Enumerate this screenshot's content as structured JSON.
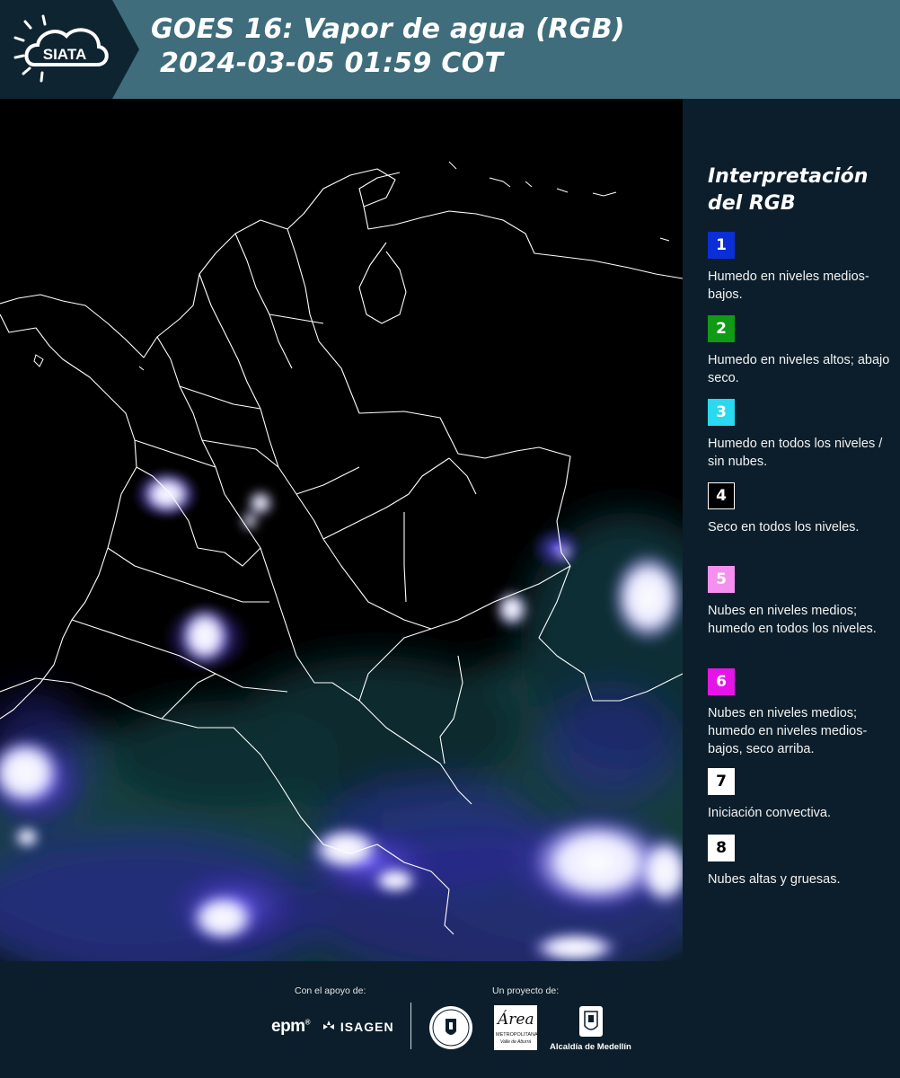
{
  "header": {
    "logo_text": "SIATA",
    "title_line1": "GOES 16: Vapor de agua (RGB)",
    "title_line2": "2024-03-05 01:59 COT"
  },
  "legend": {
    "title_line1": "Interpretación",
    "title_line2": "del RGB",
    "items": [
      {
        "number": "1",
        "color": "#0b2fd6",
        "text_color": "#ffffff",
        "description": "Humedo en niveles medios-bajos."
      },
      {
        "number": "2",
        "color": "#109a16",
        "text_color": "#ffffff",
        "description": "Humedo en niveles altos; abajo seco."
      },
      {
        "number": "3",
        "color": "#2ad8ef",
        "text_color": "#ffffff",
        "description": "Humedo en todos los niveles / sin nubes."
      },
      {
        "number": "4",
        "color": "#000000",
        "text_color": "#ffffff",
        "description": "Seco en todos los niveles."
      },
      {
        "number": "5",
        "color": "#f58ff0",
        "text_color": "#ffffff",
        "description": "Nubes en niveles medios; humedo en todos los niveles."
      },
      {
        "number": "6",
        "color": "#e415e6",
        "text_color": "#ffffff",
        "description": "Nubes en niveles medios; humedo en niveles medios-bajos, seco arriba."
      },
      {
        "number": "7",
        "color": "#ffffff",
        "text_color": "#000000",
        "description": "Iniciación convectiva."
      },
      {
        "number": "8",
        "color": "#ffffff",
        "text_color": "#000000",
        "description": "Nubes altas y gruesas."
      }
    ]
  },
  "footer": {
    "support_label": "Con el apoyo de:",
    "project_label": "Un proyecto de:",
    "epm_logo": "epm",
    "epm_mark": "®",
    "isagen_logo": "ISAGEN",
    "metro_logo_script": "Área",
    "metro_logo_line1": "METROPOLITANA",
    "metro_logo_line2": "Valle de Aburrá",
    "alcaldia_logo": "Alcaldía de Medellín"
  }
}
